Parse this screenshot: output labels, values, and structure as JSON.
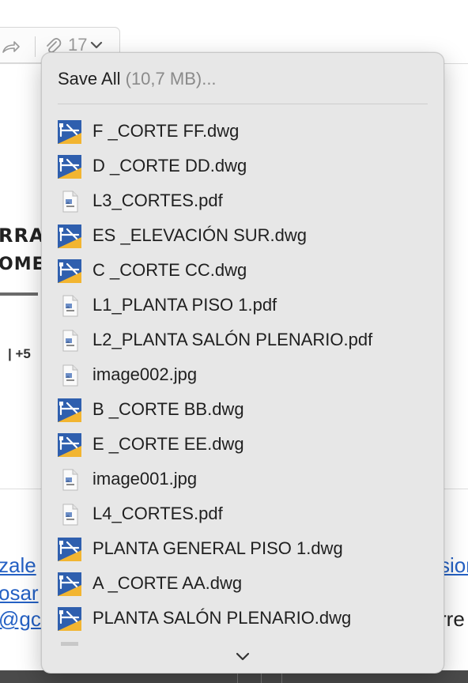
{
  "toolbar": {
    "attachment_count": "17"
  },
  "background": {
    "signature_line1": "RRA",
    "signature_line2": "OME",
    "signature_phone": "| +5",
    "link_line1": "zale",
    "link_line2": "osar",
    "link_line3": "@gc",
    "right_link": "sior",
    "right_text": "rre"
  },
  "popup": {
    "save_all_label": "Save All",
    "save_all_size": "(10,7 MB)...",
    "files": [
      {
        "name": "F _CORTE FF.dwg",
        "icon": "dwg-file-icon"
      },
      {
        "name": "D _CORTE DD.dwg",
        "icon": "dwg-file-icon"
      },
      {
        "name": "L3_CORTES.pdf",
        "icon": "document-file-icon"
      },
      {
        "name": "ES _ELEVACIÓN SUR.dwg",
        "icon": "dwg-file-icon"
      },
      {
        "name": "C _CORTE CC.dwg",
        "icon": "dwg-file-icon"
      },
      {
        "name": "L1_PLANTA PISO 1.pdf",
        "icon": "document-file-icon"
      },
      {
        "name": "L2_PLANTA SALÓN PLENARIO.pdf",
        "icon": "document-file-icon"
      },
      {
        "name": "image002.jpg",
        "icon": "document-file-icon"
      },
      {
        "name": "B _CORTE BB.dwg",
        "icon": "dwg-file-icon"
      },
      {
        "name": "E _CORTE EE.dwg",
        "icon": "dwg-file-icon"
      },
      {
        "name": "image001.jpg",
        "icon": "document-file-icon"
      },
      {
        "name": "L4_CORTES.pdf",
        "icon": "document-file-icon"
      },
      {
        "name": "PLANTA GENERAL PISO 1.dwg",
        "icon": "dwg-file-icon"
      },
      {
        "name": "A _CORTE AA.dwg",
        "icon": "dwg-file-icon"
      },
      {
        "name": "PLANTA SALÓN PLENARIO.dwg",
        "icon": "dwg-file-icon"
      }
    ]
  },
  "colors": {
    "dwg_blue": "#2f5fae",
    "dwg_yellow": "#f2b531",
    "link_blue": "#2561c4",
    "popup_bg": "#e7e7e7"
  }
}
